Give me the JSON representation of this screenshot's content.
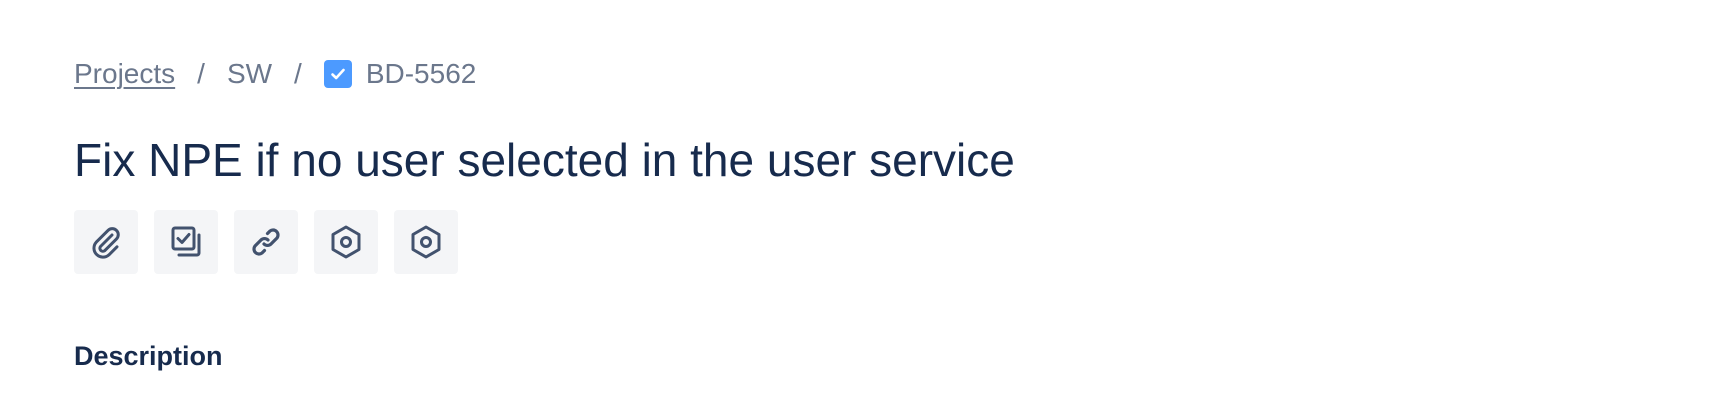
{
  "breadcrumb": {
    "projects_label": "Projects",
    "separator": "/",
    "project_key": "SW",
    "issue_key": "BD-5562"
  },
  "issue": {
    "title": "Fix NPE if no user selected in the user service"
  },
  "toolbar": {
    "buttons": [
      {
        "icon": "attachment-icon"
      },
      {
        "icon": "subtask-icon"
      },
      {
        "icon": "link-icon"
      },
      {
        "icon": "app-icon"
      },
      {
        "icon": "app-icon"
      }
    ]
  },
  "description": {
    "heading": "Description"
  },
  "colors": {
    "title_text": "#172b4d",
    "secondary_text": "#6b778c",
    "task_icon_bg": "#4c9aff",
    "button_bg": "#f4f5f7",
    "icon_color": "#42526e"
  }
}
